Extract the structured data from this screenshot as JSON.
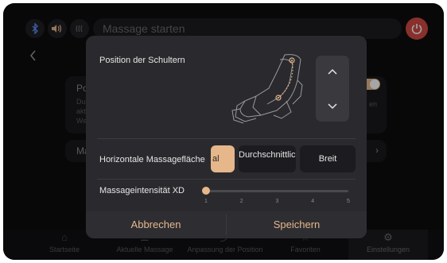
{
  "topbar": {
    "bluetooth_icon": "bluetooth-icon",
    "audio_icon": "audio-icon",
    "heat_icon": "heat-icon",
    "search_label": "Massage starten",
    "power_icon": "power-icon",
    "power_color": "#d24a44"
  },
  "background_page": {
    "card1_title": "Pos",
    "card1_desc_line1": "Du",
    "card1_desc_line2": "akt",
    "card1_desc_line3": "We",
    "card1_right_text": "en",
    "card2_title": "Ma"
  },
  "modal": {
    "shoulder_title": "Position der Schultern",
    "stepper_up_icon": "chevron-up-icon",
    "stepper_down_icon": "chevron-down-icon",
    "horizontal_label": "Horizontale Massagefläche",
    "segments": [
      {
        "label": "al",
        "selected": true
      },
      {
        "label": "Durchschnittlich",
        "selected": false
      },
      {
        "label": "Breit",
        "selected": false
      }
    ],
    "intensity_label": "Massageintensität XD",
    "intensity_value": 1,
    "intensity_ticks": [
      "1",
      "2",
      "3",
      "4",
      "5"
    ],
    "cancel_label": "Abbrechen",
    "save_label": "Speichern",
    "accent_color": "#e5b78a"
  },
  "bottom_nav": {
    "items": [
      {
        "label": "Startseite",
        "icon": "home-icon"
      },
      {
        "label": "Aktuelle Massage",
        "icon": "sliders-icon"
      },
      {
        "label": "Anpassung der Position",
        "icon": "adjust-icon"
      },
      {
        "label": "Favoriten",
        "icon": "star-icon"
      },
      {
        "label": "Einstellungen",
        "icon": "gear-icon",
        "active": true
      }
    ]
  }
}
